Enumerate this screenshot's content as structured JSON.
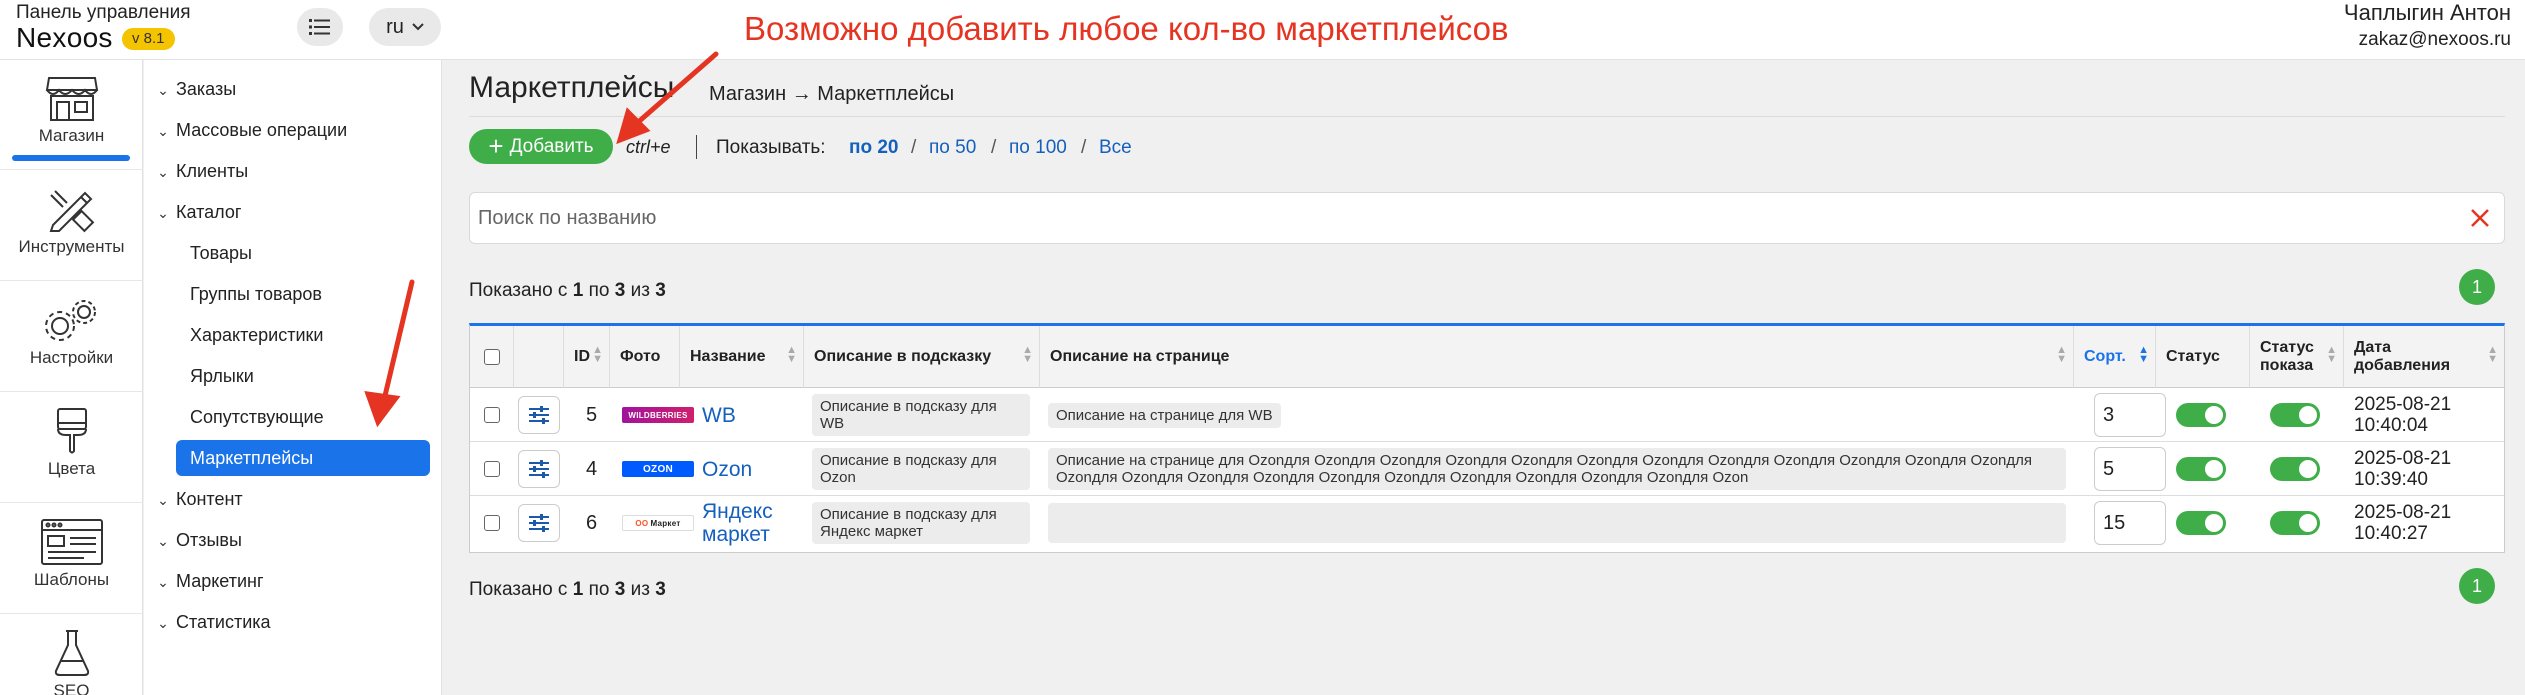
{
  "header": {
    "panel_label": "Панель управления",
    "brand": "Nexoos",
    "version": "v 8.1",
    "lang": "ru",
    "annotation": "Возможно добавить любое кол-во маркетплейсов",
    "user_name": "Чаплыгин Антон",
    "user_email": "zakaz@nexoos.ru"
  },
  "rail": [
    {
      "label": "Магазин",
      "icon": "shop-icon",
      "active": true
    },
    {
      "label": "Инструменты",
      "icon": "tools-icon"
    },
    {
      "label": "Настройки",
      "icon": "gears-icon"
    },
    {
      "label": "Цвета",
      "icon": "brush-icon"
    },
    {
      "label": "Шаблоны",
      "icon": "template-icon"
    },
    {
      "label": "SEO",
      "icon": "flask-icon"
    }
  ],
  "tree": {
    "items": [
      "Заказы",
      "Массовые операции",
      "Клиенты",
      "Каталог"
    ],
    "catalog_children": [
      "Товары",
      "Группы товаров",
      "Характеристики",
      "Ярлыки",
      "Сопутствующие",
      "Маркетплейсы"
    ],
    "items_after": [
      "Контент",
      "Отзывы",
      "Маркетинг",
      "Статистика"
    ]
  },
  "page": {
    "title": "Маркетплейсы",
    "breadcrumb": "Магазин → Маркетплейсы",
    "add_label": "Добавить",
    "hotkey": "ctrl+e",
    "show_label": "Показывать:",
    "per_page": [
      "по 20",
      "по 50",
      "по 100",
      "Все"
    ],
    "search_placeholder": "Поиск по названию",
    "shown_prefix": "Показано с",
    "shown_from": "1",
    "shown_to_word": "по",
    "shown_to": "3",
    "shown_of_word": "из",
    "shown_total": "3",
    "current_page": "1"
  },
  "table": {
    "columns": {
      "id": "ID",
      "photo": "Фото",
      "name": "Название",
      "tooltip_desc": "Описание в подсказку",
      "page_desc": "Описание на странице",
      "sort": "Сорт.",
      "status": "Статус",
      "status_show_1": "Статус",
      "status_show_2": "показа",
      "date_1": "Дата",
      "date_2": "добавления"
    },
    "rows": [
      {
        "id": "5",
        "logo": "WILDBERRIES",
        "name": "WB",
        "tooltip_desc": "Описание в подсказу для WB",
        "page_desc": "Описание на странице для WB",
        "sort": "3",
        "status": true,
        "status_show": true,
        "date": "2025-08-21",
        "time": "10:40:04"
      },
      {
        "id": "4",
        "logo": "OZON",
        "name": "Ozon",
        "tooltip_desc": "Описание в подсказу для Ozon",
        "page_desc": "Описание на странице  для Ozonдля Ozonдля Ozonдля Ozonдля Ozonдля Ozonдля Ozonдля Ozonдля Ozonдля Ozonдля Ozonдля Ozonдля Ozonдля Ozonдля Ozonдля Ozonдля Ozonдля Ozonдля Ozonдля Ozonдля Ozonдля Ozonдля Ozon",
        "sort": "5",
        "status": true,
        "status_show": true,
        "date": "2025-08-21",
        "time": "10:39:40"
      },
      {
        "id": "6",
        "logo": "Маркет",
        "name": "Яндекс маркет",
        "tooltip_desc": "Описание в подсказу для Яндекс маркет",
        "page_desc": "",
        "sort": "15",
        "status": true,
        "status_show": true,
        "date": "2025-08-21",
        "time": "10:40:27"
      }
    ]
  },
  "colors": {
    "accent_blue": "#1a73e8",
    "green": "#3fae49",
    "annotation_red": "#e53522",
    "version_yellow": "#f4c400"
  }
}
